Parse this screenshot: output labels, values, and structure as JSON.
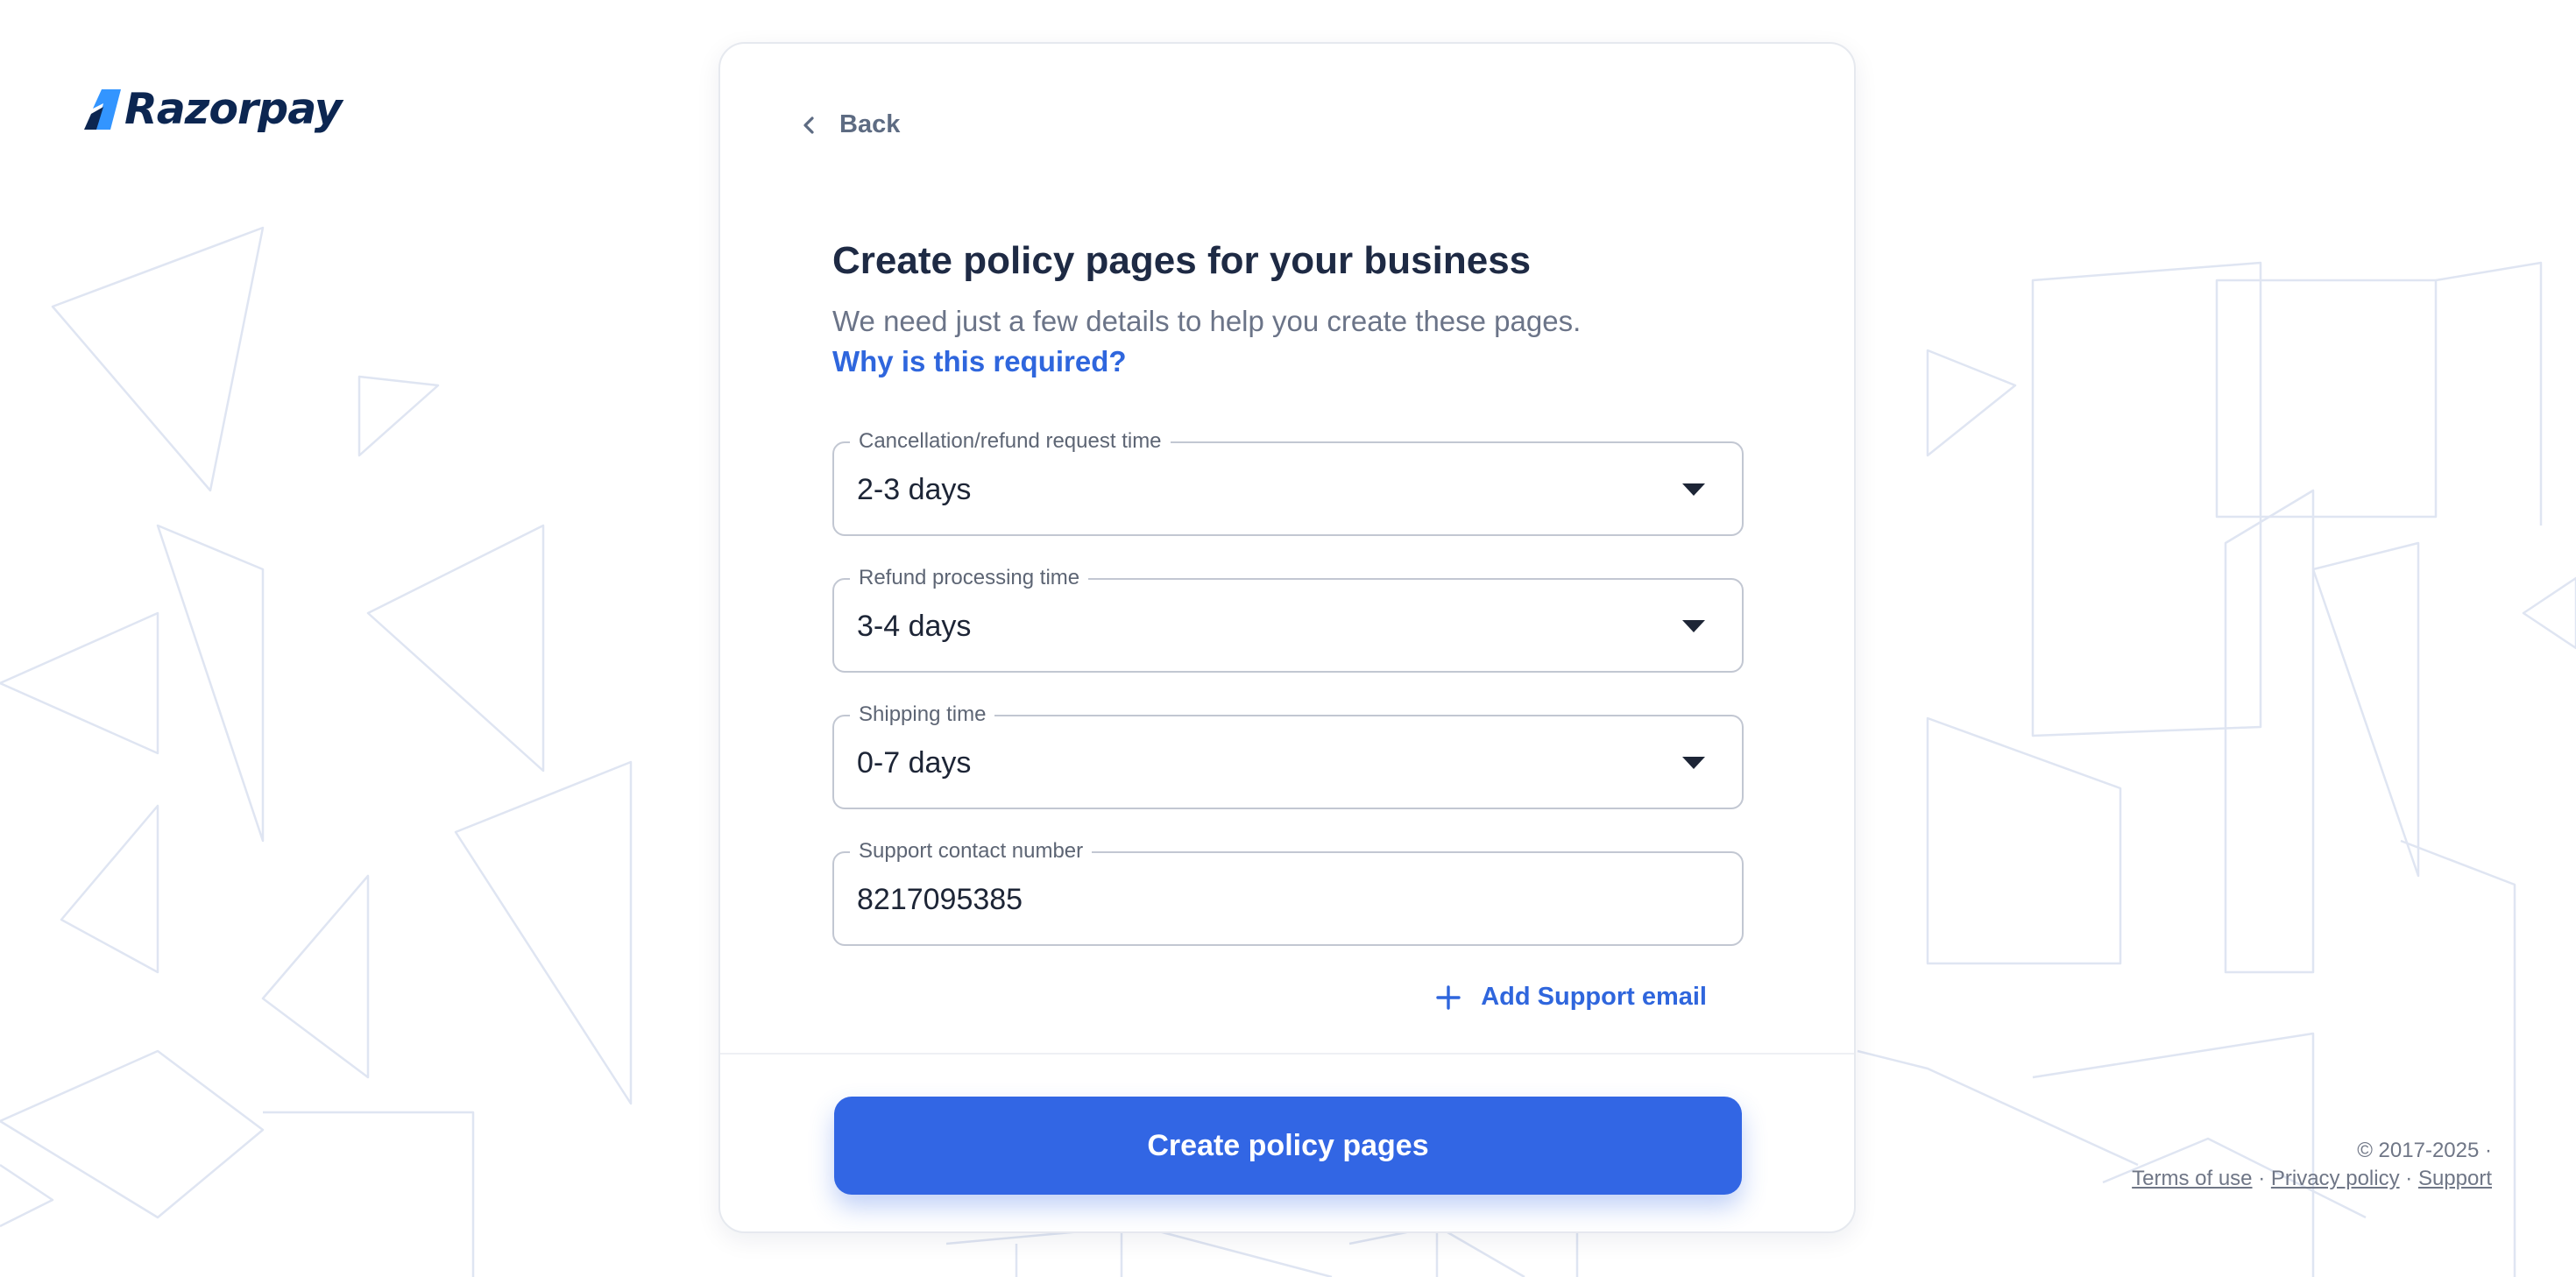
{
  "brand": {
    "name": "Razorpay",
    "logo_color": "#0c2651",
    "logo_accent": "#3395ff"
  },
  "back": {
    "label": "Back",
    "icon": "chevron-left-icon"
  },
  "header": {
    "title": "Create policy pages for your business",
    "subtitle": "We need just a few details to help you create these pages.",
    "why_link": "Why is this required?"
  },
  "fields": {
    "cancellation": {
      "label": "Cancellation/refund request time",
      "value": "2-3 days"
    },
    "refund": {
      "label": "Refund processing time",
      "value": "3-4 days"
    },
    "shipping": {
      "label": "Shipping time",
      "value": "0-7 days"
    },
    "support_phone": {
      "label": "Support contact number",
      "value": "8217095385"
    }
  },
  "add_email": {
    "label": "Add Support email",
    "icon": "plus-icon"
  },
  "submit": {
    "label": "Create policy pages"
  },
  "footer": {
    "copyright": "© 2017-2025 ·",
    "terms": "Terms of use",
    "privacy": "Privacy policy",
    "support": "Support",
    "separator": "·"
  },
  "colors": {
    "accent": "#3266e4",
    "link": "#2f66dd",
    "title": "#1e2a44",
    "muted": "#6b7488",
    "border": "#c2c7d2"
  }
}
